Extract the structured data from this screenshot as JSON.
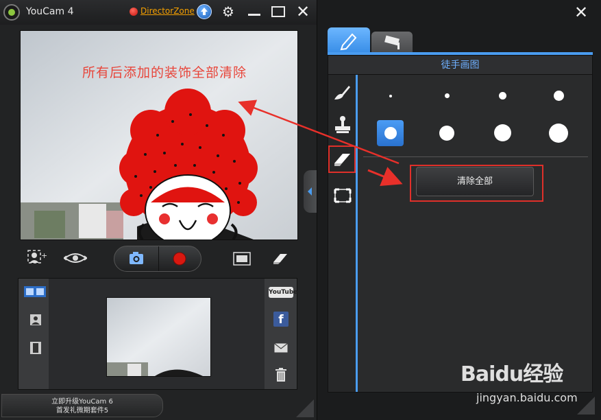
{
  "app": {
    "title": "YouCam 4",
    "director_zone": "DirectorZone"
  },
  "preview": {
    "annotation": "所有后添加的装饰全部清除"
  },
  "sidebar": {
    "upgrade_line1": "立即升级YouCam 6",
    "upgrade_line2": "首发礼微期套件5"
  },
  "share": {
    "youtube": "YouTube"
  },
  "panel": {
    "header": "徒手画图",
    "clear_all": "清除全部",
    "selected_brush_index": 0
  },
  "watermark": {
    "brand": "Baidu经验",
    "url": "jingyan.baidu.com"
  },
  "colors": {
    "accent": "#4a9cf0",
    "highlight_red": "#e0302a",
    "link": "#f5a000"
  }
}
